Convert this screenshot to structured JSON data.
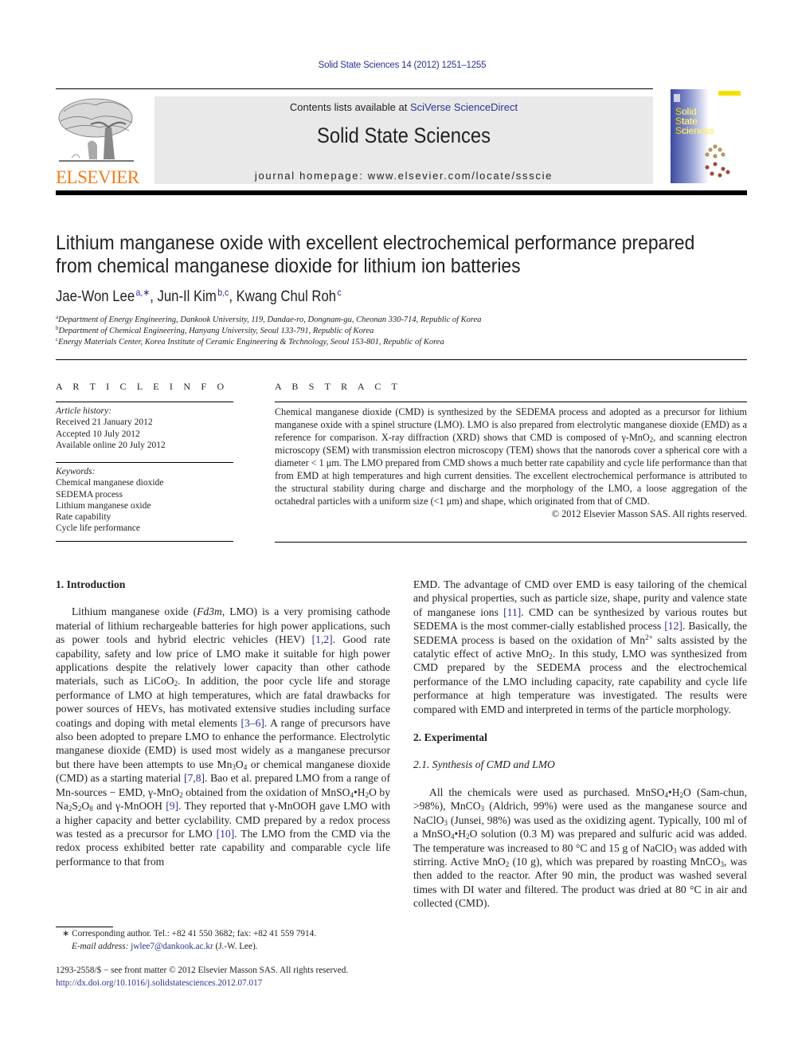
{
  "header": {
    "citation": "Solid State Sciences 14 (2012) 1251–1255",
    "contents_prefix": "Contents lists available at ",
    "contents_link": "SciVerse ScienceDirect",
    "journal_title": "Solid State Sciences",
    "homepage": "journal homepage: www.elsevier.com/locate/ssscie",
    "publisher_logo_text": "ELSEVIER",
    "cover_title_lines": [
      "Solid",
      "State",
      "Sciences"
    ],
    "colors": {
      "link": "#2e3192",
      "elsevier_orange": "#f07e1a",
      "masthead_bg": "#e9e9e9",
      "cover_blue": "#3b4aa0",
      "cover_yellow": "#f5e000"
    }
  },
  "article": {
    "title_line1": "Lithium manganese oxide with excellent electrochemical performance prepared",
    "title_line2": "from chemical manganese dioxide for lithium ion batteries",
    "authors": [
      {
        "name": "Jae-Won Lee",
        "marks": "a,∗",
        "sep": ", "
      },
      {
        "name": "Jun-Il Kim",
        "marks": "b,c",
        "sep": ", "
      },
      {
        "name": "Kwang Chul Roh",
        "marks": "c",
        "sep": ""
      }
    ],
    "affiliations": [
      {
        "mark": "a",
        "text": "Department of Energy Engineering, Dankook University, 119, Dandae-ro, Dongnam-gu, Cheonan 330-714, Republic of Korea"
      },
      {
        "mark": "b",
        "text": "Department of Chemical Engineering, Hanyang University, Seoul 133-791, Republic of Korea"
      },
      {
        "mark": "c",
        "text": "Energy Materials Center, Korea Institute of Ceramic Engineering & Technology, Seoul 153-801, Republic of Korea"
      }
    ]
  },
  "article_info": {
    "label": "A R T I C L E   I N F O",
    "history_heading": "Article history:",
    "history": [
      "Received 21 January 2012",
      "Accepted 10 July 2012",
      "Available online 20 July 2012"
    ],
    "keywords_heading": "Keywords:",
    "keywords": [
      "Chemical manganese dioxide",
      "SEDEMA process",
      "Lithium manganese oxide",
      "Rate capability",
      "Cycle life performance"
    ]
  },
  "abstract": {
    "label": "A B S T R A C T",
    "p1": "Chemical manganese dioxide (CMD) is synthesized by the SEDEMA process and adopted as a precursor for lithium manganese oxide with a spinel structure (LMO). LMO is also prepared from electrolytic manganese dioxide (EMD) as a reference for comparison. X-ray diffraction (XRD) shows that CMD is composed of γ-MnO",
    "p1_sub": "2",
    "p2": ", and scanning electron microscopy (SEM) with transmission electron microscopy (TEM) shows that the nanorods cover a spherical core with a diameter < 1 μm. The LMO prepared from CMD shows a much better rate capability and cycle life performance than that from EMD at high temperatures and high current densities. The excellent electrochemical performance is attributed to the structural stability during charge and discharge and the morphology of the LMO, a loose aggregation of the octahedral particles with a uniform size (<1 μm) and shape, which originated from that of CMD.",
    "copyright": "© 2012 Elsevier Masson SAS. All rights reserved."
  },
  "intro": {
    "heading": "1.  Introduction",
    "t1": "Lithium manganese oxide (",
    "t1_italic": "Fd3m",
    "t2": ", LMO) is a very promising cathode material of lithium rechargeable batteries for high power applications, such as power tools and hybrid electric vehicles (HEV) ",
    "ref1": "[1,2]",
    "t3": ". Good rate capability, safety and low price of LMO make it suitable for high power applications despite the relatively lower capacity than other cathode materials, such as LiCoO",
    "t3_sub": "2",
    "t4": ". In addition, the poor cycle life and storage performance of LMO at high temperatures, which are fatal drawbacks for power sources of HEVs, has motivated extensive studies including surface coatings and doping with metal elements ",
    "ref2": "[3–6]",
    "t5": ". A range of precursors have also been adopted to prepare LMO to enhance the performance. Electrolytic manganese dioxide (EMD) is used most widely as a manganese precursor but there have been attempts to use Mn",
    "t5_sub1": "3",
    "t5b": "O",
    "t5_sub2": "4",
    "t6": " or chemical manganese dioxide (CMD) as a starting material ",
    "ref3": "[7,8]",
    "t7": ". Bao et al. prepared LMO from a range of Mn-sources − EMD, γ-MnO",
    "t7_sub": "2",
    "t8": " obtained from the oxidation of MnSO",
    "t8_sub": "4",
    "t8b": "•H",
    "t8_sub2": "2",
    "t8c": "O by Na",
    "t8_sub3": "2",
    "t8d": "S",
    "t8_sub4": "2",
    "t8e": "O",
    "t8_sub5": "8",
    "t9": " and γ-MnOOH ",
    "ref4": "[9]",
    "t10": ". They reported that γ-MnOOH gave LMO with a higher capacity and better cyclability. CMD prepared by a redox process was tested as a precursor for LMO ",
    "ref5": "[10]",
    "t11": ". The LMO from the CMD via the redox process exhibited better rate capability and comparable cycle life performance to that from EMD. The advantage of CMD over EMD is easy tailoring of the chemical and physical properties, such as particle size, shape, purity and valence state of manganese ions ",
    "ref6": "[11]",
    "t12": ". CMD can be synthesized by various routes but SEDEMA is the most commer-cially established process ",
    "ref7": "[12]",
    "t13": ". Basically, the SEDEMA process is based on the oxidation of Mn",
    "t13_sup": "2+",
    "t14": " salts assisted by the catalytic effect of active MnO",
    "t14_sub": "2",
    "t15": ". In this study, LMO was synthesized from CMD prepared by the SEDEMA process and the electrochemical performance of the LMO including capacity, rate capability and cycle life performance at high temperature was investigated. The results were compared with EMD and interpreted in terms of the particle morphology."
  },
  "experimental": {
    "heading": "2.  Experimental",
    "subheading": "2.1.  Synthesis of CMD and LMO",
    "e1": "All the chemicals were used as purchased. MnSO",
    "e1_sub": "4",
    "e1b": "•H",
    "e1_sub2": "2",
    "e2": "O (Sam-chun, >98%), MnCO",
    "e2_sub": "3",
    "e3": " (Aldrich, 99%) were used as the manganese source and NaClO",
    "e3_sub": "3",
    "e4": " (Junsei, 98%) was used as the oxidizing agent. Typically, 100 ml of a MnSO",
    "e4_sub": "4",
    "e4b": "•H",
    "e4_sub2": "2",
    "e5": "O solution (0.3 M) was prepared and sulfuric acid was added. The temperature was increased to 80 °C and 15 g of NaClO",
    "e5_sub": "3",
    "e6": " was added with stirring. Active MnO",
    "e6_sub": "2",
    "e7": " (10 g), which was prepared by roasting MnCO",
    "e7_sub": "3",
    "e8": ", was then added to the reactor. After 90 min, the product was washed several times with DI water and filtered. The product was dried at 80 °C in air and collected (CMD)."
  },
  "footnotes": {
    "corresponding": "∗  Corresponding author. Tel.: +82 41 550 3682; fax: +82 41 559 7914.",
    "email_label": "E-mail address: ",
    "email": "jwlee7@dankook.ac.kr",
    "email_suffix": " (J.-W. Lee).",
    "front_matter": "1293-2558/$ − see front matter © 2012 Elsevier Masson SAS. All rights reserved.",
    "doi": "http://dx.doi.org/10.1016/j.solidstatesciences.2012.07.017"
  }
}
